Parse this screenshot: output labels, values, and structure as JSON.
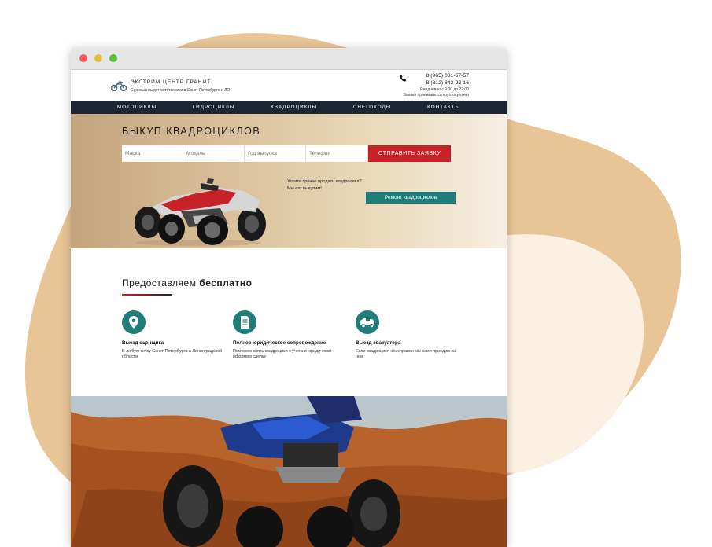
{
  "colors": {
    "blob": "#e8c597",
    "blob_light": "#fbf1e2",
    "nav_bg": "#1d2535",
    "accent_red": "#c82128",
    "accent_teal": "#1f7d7a"
  },
  "window_controls": [
    "close-dot",
    "minimize-dot",
    "maximize-dot"
  ],
  "header": {
    "brand": "ЭКСТРИМ ЦЕНТР ГРАНИТ",
    "tagline": "Срочный выкуп мототехники в Санкт-Петербурге и ЛО",
    "phone1": "8 (965) 081-57-57",
    "phone2": "8 (812) 642-92-16",
    "hours": "Ежедневно с 9:00 до 22:00",
    "note": "Заявки принимаются круглосуточно"
  },
  "nav": {
    "items": [
      "МОТОЦИКЛЫ",
      "ГИДРОЦИКЛЫ",
      "КВАДРОЦИКЛЫ",
      "СНЕГОХОДЫ",
      "КОНТАКТЫ"
    ]
  },
  "hero": {
    "title": "ВЫКУП КВАДРОЦИКЛОВ",
    "form": {
      "brand_placeholder": "Марка",
      "model_placeholder": "Модель",
      "year_placeholder": "Год выпуска",
      "phone_placeholder": "Телефон",
      "submit_label": "ОТПРАВИТЬ ЗАЯВКУ"
    },
    "promo_line1": "Хотите срочно продать квадроцикл?",
    "promo_line2": "Мы его выкупим!",
    "repair_label": "Ремонт квадроциклов"
  },
  "free": {
    "title_prefix": "Предоставляем",
    "title_bold": "бесплатно",
    "features": [
      {
        "icon": "location-pin-icon",
        "title": "Выезд оценщика",
        "desc": "В любую точку Санкт-Петербурга и Ленинградской области"
      },
      {
        "icon": "document-icon",
        "title": "Полное юридическое сопровождение",
        "desc": "Поможем снять квадроцикл с учета и юридически оформим сделку"
      },
      {
        "icon": "tow-truck-icon",
        "title": "Выезд эвакуатора",
        "desc": "Если квадроцикл неисправен мы сами приедим за ним"
      }
    ]
  },
  "photo": {
    "subject": "atv-in-sand-photo"
  }
}
